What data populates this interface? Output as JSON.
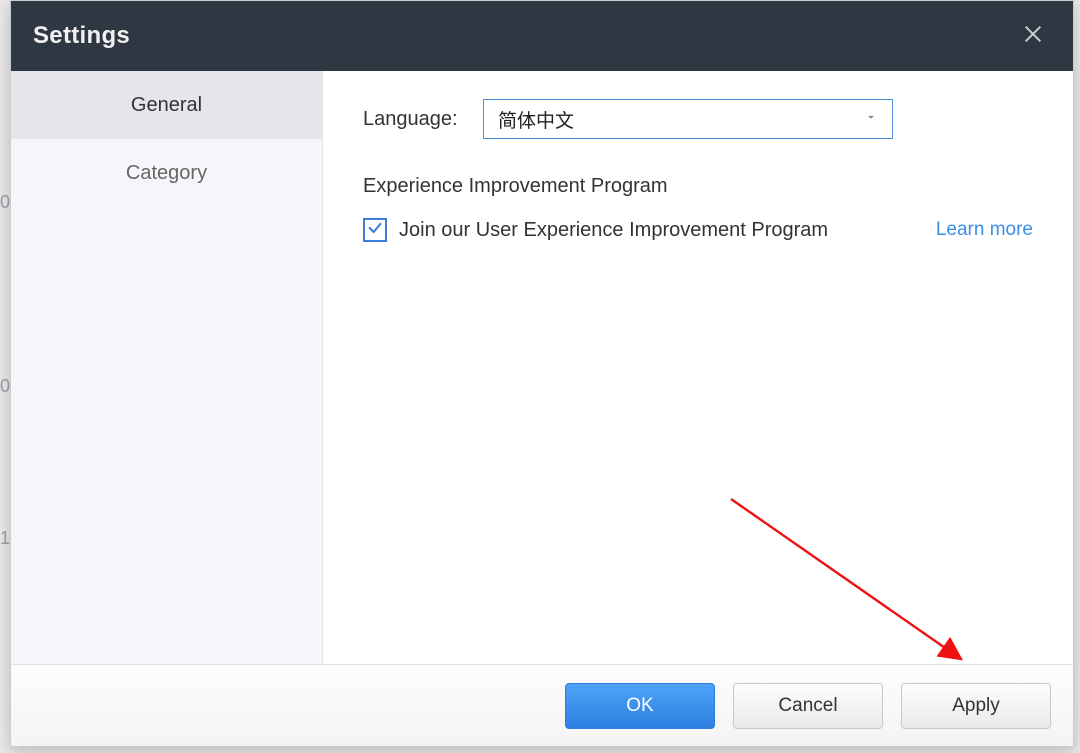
{
  "dialog": {
    "title": "Settings"
  },
  "sidebar": {
    "tabs": [
      {
        "label": "General",
        "active": true
      },
      {
        "label": "Category",
        "active": false
      }
    ]
  },
  "content": {
    "language_label": "Language:",
    "language_value": "简体中文",
    "section_title": "Experience Improvement Program",
    "checkbox_label": "Join our User Experience Improvement Program",
    "checkbox_checked": true,
    "learn_more": "Learn more"
  },
  "footer": {
    "ok": "OK",
    "cancel": "Cancel",
    "apply": "Apply"
  }
}
